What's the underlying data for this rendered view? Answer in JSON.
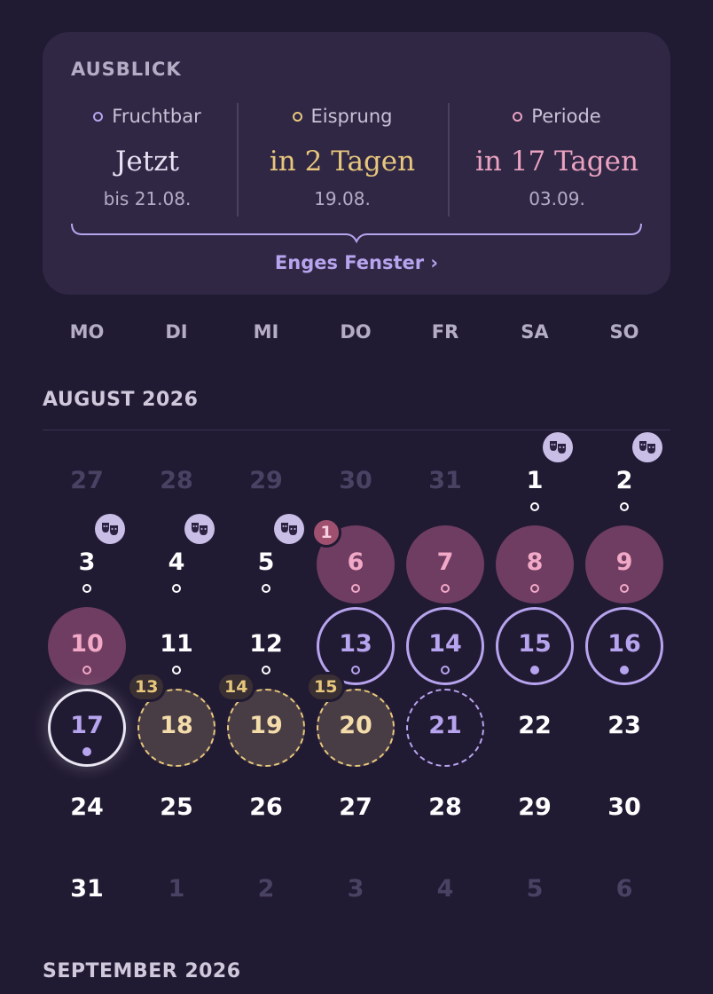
{
  "outlook": {
    "title": "AUSBLICK",
    "columns": [
      {
        "label": "Fruchtbar",
        "value": "Jetzt",
        "date": "bis 21.08.",
        "color": "#b7a4ee"
      },
      {
        "label": "Eisprung",
        "value": "in 2 Tagen",
        "date": "19.08.",
        "color": "#e8c77c"
      },
      {
        "label": "Periode",
        "value": "in 17 Tagen",
        "date": "03.09.",
        "color": "#eaa2c0"
      }
    ],
    "cta": "Enges Fenster ›"
  },
  "weekdays": [
    "MO",
    "DI",
    "MI",
    "DO",
    "FR",
    "SA",
    "SO"
  ],
  "months": [
    {
      "label": "AUGUST 2026"
    },
    {
      "label": "SEPTEMBER 2026"
    }
  ],
  "legend": {
    "period_color": "#6e3d61",
    "fertile_color": "#b7a4ee",
    "ovulation_color": "#e8c77c",
    "today_color": "#ffffff",
    "badge_period_color": "#a0506f"
  },
  "calendar_days": [
    {
      "n": "27",
      "t": "muted"
    },
    {
      "n": "28",
      "t": "muted"
    },
    {
      "n": "29",
      "t": "muted"
    },
    {
      "n": "30",
      "t": "muted"
    },
    {
      "n": "31",
      "t": "muted"
    },
    {
      "n": "1",
      "t": "dot",
      "mask": true
    },
    {
      "n": "2",
      "t": "dot",
      "mask": true
    },
    {
      "n": "3",
      "t": "dot",
      "mask": true
    },
    {
      "n": "4",
      "t": "dot",
      "mask": true
    },
    {
      "n": "5",
      "t": "dot",
      "mask": true
    },
    {
      "n": "6",
      "t": "period",
      "badge": "1"
    },
    {
      "n": "7",
      "t": "period"
    },
    {
      "n": "8",
      "t": "period"
    },
    {
      "n": "9",
      "t": "period"
    },
    {
      "n": "10",
      "t": "period"
    },
    {
      "n": "11",
      "t": "dot"
    },
    {
      "n": "12",
      "t": "dot"
    },
    {
      "n": "13",
      "t": "fertile"
    },
    {
      "n": "14",
      "t": "fertile"
    },
    {
      "n": "15",
      "t": "fertile-filled"
    },
    {
      "n": "16",
      "t": "fertile-filled"
    },
    {
      "n": "17",
      "t": "today"
    },
    {
      "n": "18",
      "t": "ovulation",
      "badge": "13"
    },
    {
      "n": "19",
      "t": "ovulation",
      "badge": "14"
    },
    {
      "n": "20",
      "t": "ovulation",
      "badge": "15"
    },
    {
      "n": "21",
      "t": "dashed"
    },
    {
      "n": "22",
      "t": "plain"
    },
    {
      "n": "23",
      "t": "plain"
    },
    {
      "n": "24",
      "t": "plain"
    },
    {
      "n": "25",
      "t": "plain"
    },
    {
      "n": "26",
      "t": "plain"
    },
    {
      "n": "27",
      "t": "plain"
    },
    {
      "n": "28",
      "t": "plain"
    },
    {
      "n": "29",
      "t": "plain"
    },
    {
      "n": "30",
      "t": "plain"
    },
    {
      "n": "31",
      "t": "plain"
    },
    {
      "n": "1",
      "t": "muted"
    },
    {
      "n": "2",
      "t": "muted"
    },
    {
      "n": "3",
      "t": "muted"
    },
    {
      "n": "4",
      "t": "muted"
    },
    {
      "n": "5",
      "t": "muted"
    },
    {
      "n": "6",
      "t": "muted"
    }
  ]
}
